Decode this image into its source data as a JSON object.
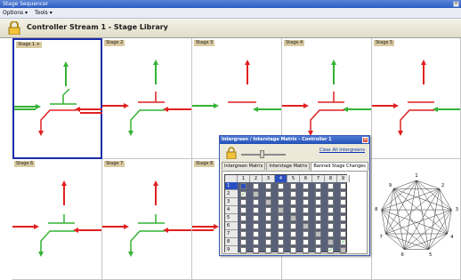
{
  "window": {
    "title": "Stage Sequencer",
    "close_glyph": "×"
  },
  "menu": {
    "items": [
      {
        "label": "Options ▾"
      },
      {
        "label": "Tools ▾"
      }
    ]
  },
  "header": {
    "title": "Controller Stream 1 - Stage Library",
    "icon": "lock-icon"
  },
  "stages": [
    {
      "label": "Stage 1 +",
      "selected": true
    },
    {
      "label": "Stage 2"
    },
    {
      "label": "Stage 3"
    },
    {
      "label": "Stage 4"
    },
    {
      "label": "Stage 5"
    },
    {
      "label": "Stage 6"
    },
    {
      "label": "Stage 7"
    },
    {
      "label": "Stage 8"
    }
  ],
  "dialog": {
    "title": "Intergreen / Interstage Matrix - Controller 1",
    "close_glyph": "×",
    "clear_label": "Clear All Intergreens",
    "tabs": [
      {
        "label": "Intergreen Matrix"
      },
      {
        "label": "Interstage Matrix"
      },
      {
        "label": "Banned Stage Changes",
        "active": true
      }
    ],
    "matrix": {
      "col_headers": [
        "1",
        "2",
        "3",
        "4",
        "5",
        "6",
        "7",
        "8",
        "9"
      ],
      "row_headers": [
        "1",
        "2",
        "3",
        "4",
        "5",
        "6",
        "7",
        "8",
        "9"
      ],
      "active_col": "4",
      "active_row": "1",
      "checked": [
        [
          2,
          1
        ],
        [
          8,
          9
        ],
        [
          9,
          8
        ]
      ]
    }
  },
  "conflict_graph": {
    "nodes": [
      "1",
      "2",
      "3",
      "4",
      "5",
      "6",
      "7",
      "8",
      "9"
    ]
  },
  "colors": {
    "green_signal": "#34b233",
    "red_signal": "#e02020",
    "selection": "#1a2da8"
  }
}
